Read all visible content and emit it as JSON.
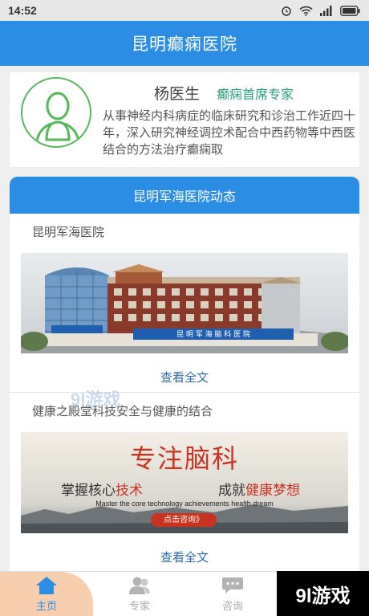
{
  "status_bar": {
    "time": "14:52",
    "icons": [
      "alarm-icon",
      "wifi-icon",
      "signal-icon",
      "battery-icon"
    ]
  },
  "header": {
    "title": "昆明癫痫医院"
  },
  "doctor": {
    "name": "杨医生",
    "title": "癫痫首席专家",
    "description": "从事神经内科病症的临床研究和诊治工作近四十年，深入研究神经调控术配合中西药物等中西医结合的方法治疗癫痫取"
  },
  "news": {
    "header": "昆明军海医院动态",
    "articles": [
      {
        "title": "昆明军海医院",
        "image": "hospital-building",
        "sign_text": "昆 明 军 海 脑 科 医 院",
        "read_more": "查看全文"
      },
      {
        "title": "健康之殿堂科技安全与健康的结合",
        "image": "brain-banner",
        "read_more": "查看全文"
      }
    ]
  },
  "banner": {
    "headline": "专注脑科",
    "slogan_a": "掌握核心",
    "slogan_a_hl": "技术",
    "slogan_b": "成就",
    "slogan_b_hl": "健康梦想",
    "english": "Master the core technology achievements health dream",
    "button": "点击咨询》"
  },
  "tabs": [
    {
      "label": "主页",
      "icon": "home-icon",
      "active": true
    },
    {
      "label": "专家",
      "icon": "expert-icon",
      "active": false
    },
    {
      "label": "咨询",
      "icon": "chat-icon",
      "active": false
    }
  ],
  "watermark": {
    "bottom": "9l游戏",
    "middle": "9l游戏"
  },
  "colors": {
    "primary": "#2b8de3",
    "accent_green": "#29a07c",
    "banner_red": "#c8321e",
    "tab_active_bg": "#f7cfae"
  }
}
